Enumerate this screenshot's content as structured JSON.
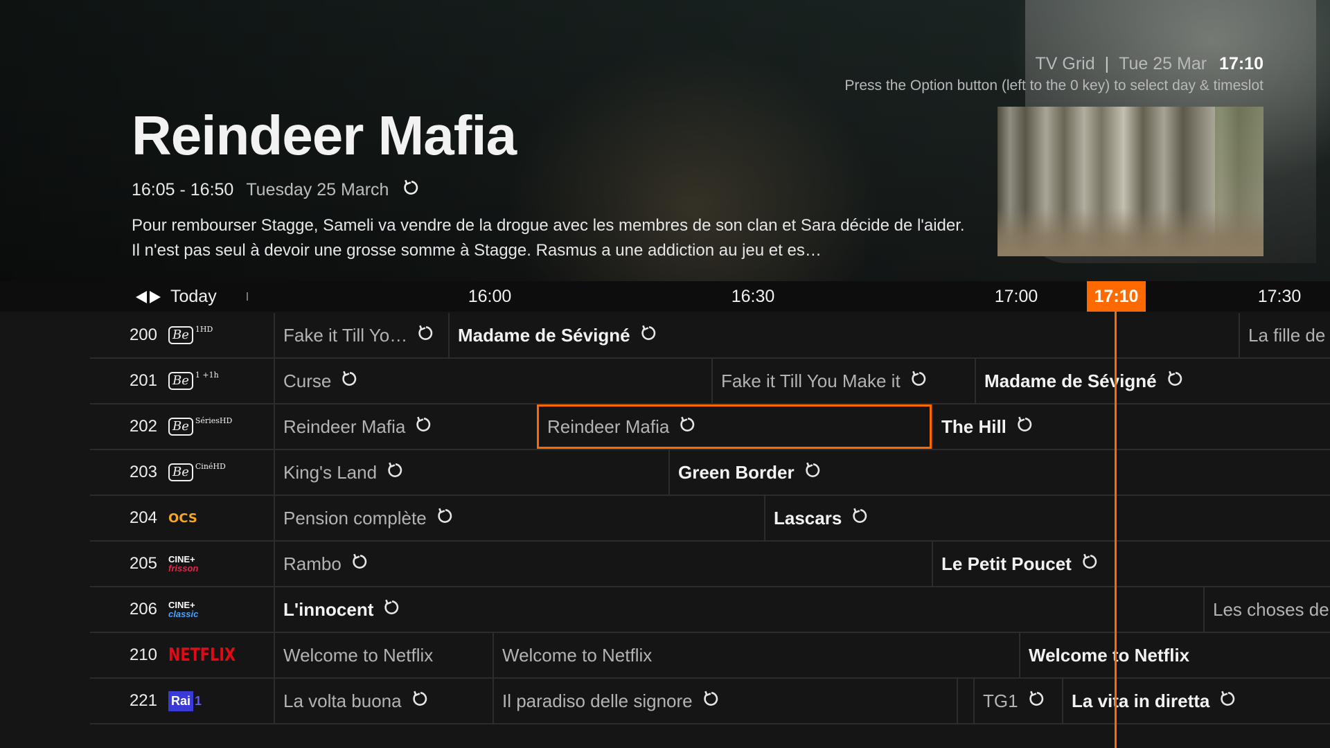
{
  "header": {
    "section": "TV Grid",
    "date": "Tue 25 Mar",
    "time": "17:10",
    "hint": "Press the Option button (left to the 0 key) to select day & timeslot"
  },
  "program": {
    "title": "Reindeer Mafia",
    "time": "16:05 - 16:50",
    "date": "Tuesday 25 March",
    "replay_icon": "replay-icon",
    "description": "Pour rembourser Stagge, Sameli va vendre de la drogue avec les membres de son clan et Sara décide de l'aider. Il n'est pas seul à devoir une grosse somme à Stagge. Rasmus a une addiction au jeu et es…"
  },
  "timebar": {
    "day": "Today",
    "ticks": [
      "16:00",
      "16:30",
      "17:00",
      "17:30"
    ],
    "now": "17:10"
  },
  "colors": {
    "accent": "#ff6a00",
    "background": "#151515"
  },
  "channels": [
    {
      "num": "200",
      "logo": "be1-hd",
      "logo_text": "Be",
      "logo_sup": "1HD",
      "programs": [
        {
          "title": "Fake it Till Yo…",
          "replay": true
        },
        {
          "title": "Madame de Sévigné",
          "replay": true,
          "bold": true
        },
        {
          "title": "La fille de s"
        }
      ]
    },
    {
      "num": "201",
      "logo": "be1-plus1h",
      "logo_text": "Be",
      "logo_sup": "1 +1h",
      "programs": [
        {
          "title": "Curse",
          "replay": true
        },
        {
          "title": "Fake it Till You Make it",
          "replay": true
        },
        {
          "title": "Madame de Sévigné",
          "replay": true,
          "bold": true
        }
      ]
    },
    {
      "num": "202",
      "logo": "be-series-hd",
      "logo_text": "Be",
      "logo_sup": "SériesHD",
      "programs": [
        {
          "title": "Reindeer Mafia",
          "replay": true
        },
        {
          "title": "Reindeer Mafia",
          "replay": true,
          "selected": true
        },
        {
          "title": "The Hill",
          "replay": true,
          "bold": true
        }
      ]
    },
    {
      "num": "203",
      "logo": "be-cine-hd",
      "logo_text": "Be",
      "logo_sup": "CinéHD",
      "programs": [
        {
          "title": "King's Land",
          "replay": true
        },
        {
          "title": "Green Border",
          "replay": true,
          "bold": true
        }
      ]
    },
    {
      "num": "204",
      "logo": "ocs",
      "logo_text": "OCS",
      "programs": [
        {
          "title": "Pension complète",
          "replay": true
        },
        {
          "title": "Lascars",
          "replay": true,
          "bold": true
        }
      ]
    },
    {
      "num": "205",
      "logo": "cine-frisson",
      "logo_text": "CINE+",
      "logo_sub": "frisson",
      "programs": [
        {
          "title": "Rambo",
          "replay": true
        },
        {
          "title": "Le Petit Poucet",
          "replay": true,
          "bold": true
        }
      ]
    },
    {
      "num": "206",
      "logo": "cine-classic",
      "logo_text": "CINE+",
      "logo_sub": "classic",
      "programs": [
        {
          "title": "L'innocent",
          "replay": true,
          "bold": true
        },
        {
          "title": "Les choses de"
        }
      ]
    },
    {
      "num": "210",
      "logo": "netflix",
      "logo_text": "NETFLIX",
      "programs": [
        {
          "title": "Welcome to Netflix"
        },
        {
          "title": "Welcome to Netflix"
        },
        {
          "title": "Welcome to Netflix",
          "bold": true
        }
      ]
    },
    {
      "num": "221",
      "logo": "rai-1",
      "logo_text": "Rai",
      "logo_sub": "1",
      "programs": [
        {
          "title": "La volta buona",
          "replay": true
        },
        {
          "title": "Il paradiso delle signore",
          "replay": true
        },
        {
          "title": ""
        },
        {
          "title": "TG1",
          "replay": true
        },
        {
          "title": "La vita in diretta",
          "replay": true,
          "bold": true
        }
      ]
    }
  ]
}
